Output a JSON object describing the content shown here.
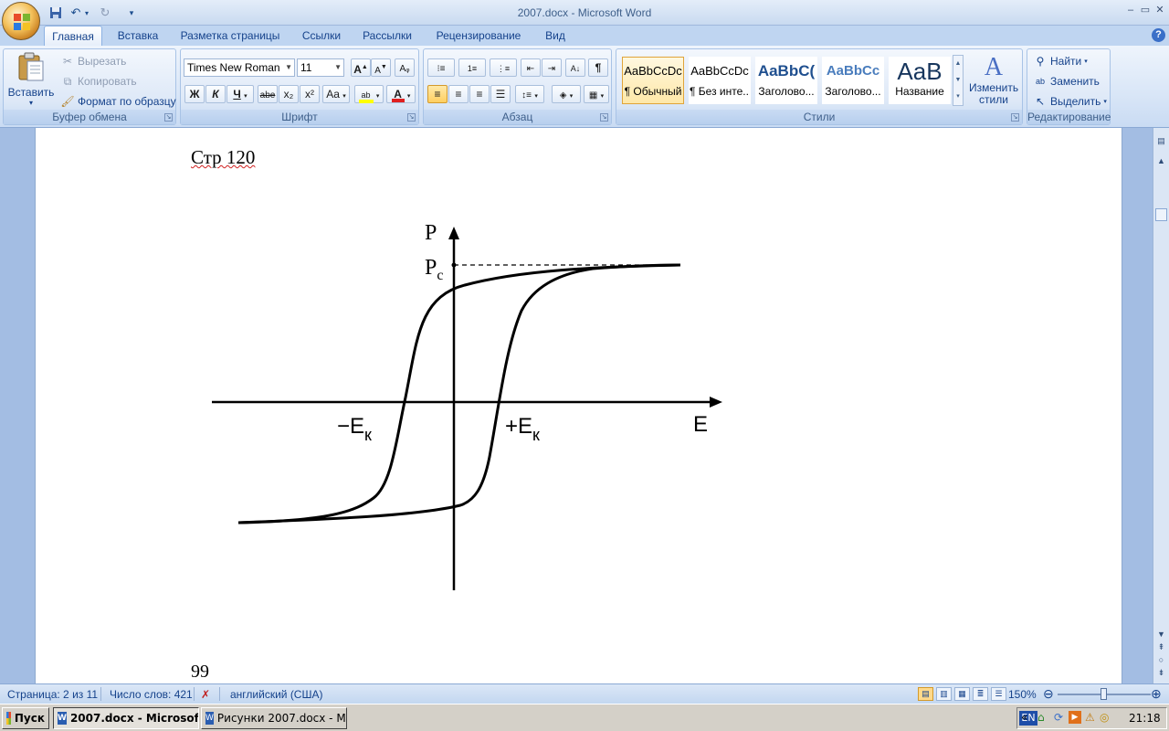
{
  "window": {
    "title": "2007.docx - Microsoft Word",
    "controls": [
      "–",
      "▭",
      "✕"
    ]
  },
  "qat": {
    "save": "save-icon",
    "undo": "undo-icon",
    "redo": "redo-icon"
  },
  "tabs": [
    "Главная",
    "Вставка",
    "Разметка страницы",
    "Ссылки",
    "Рассылки",
    "Рецензирование",
    "Вид"
  ],
  "active_tab": "Главная",
  "ribbon": {
    "clipboard": {
      "label": "Буфер обмена",
      "paste": "Вставить",
      "cut": "Вырезать",
      "copy": "Копировать",
      "format_painter": "Формат по образцу"
    },
    "font": {
      "label": "Шрифт",
      "font_name": "Times New Roman",
      "font_size": "11",
      "bold": "Ж",
      "italic": "К",
      "underline": "Ч",
      "strike": "abe",
      "subscript": "x₂",
      "superscript": "x²",
      "change_case": "Aa",
      "grow": "A",
      "shrink": "A",
      "highlight_color": "#ffff00",
      "font_color": "#e02020"
    },
    "paragraph": {
      "label": "Абзац"
    },
    "styles": {
      "label": "Стили",
      "items": [
        {
          "preview": "AaBbCcDc",
          "name": "¶ Обычный"
        },
        {
          "preview": "AaBbCcDc",
          "name": "¶ Без инте..."
        },
        {
          "preview": "AaBbC(",
          "name": "Заголово..."
        },
        {
          "preview": "AaBbCc",
          "name": "Заголово..."
        },
        {
          "preview": "AaB",
          "name": "Название"
        }
      ],
      "change_styles": "Изменить стили"
    },
    "editing": {
      "label": "Редактирование",
      "find": "Найти",
      "replace": "Заменить",
      "select": "Выделить"
    }
  },
  "document": {
    "heading": "Стр 120",
    "page_number": "99",
    "figure": {
      "axis_p": "P",
      "axis_e": "E",
      "label_pc": "P",
      "label_pc_sub": "c",
      "label_neg_ek": "−E",
      "label_pos_ek": "+E",
      "ek_sub": "к"
    }
  },
  "status": {
    "page": "Страница: 2 из 11",
    "words": "Число слов: 421",
    "language": "английский (США)",
    "zoom": "150%",
    "zoom_fraction": 0.5
  },
  "taskbar": {
    "start": "Пуск",
    "items": [
      "2007.docx - Microsoft...",
      "Рисунки 2007.docx - Mic..."
    ],
    "lang": "EN",
    "time": "21:18"
  }
}
